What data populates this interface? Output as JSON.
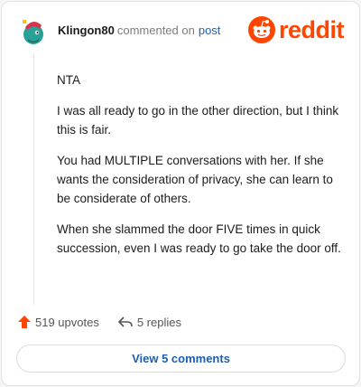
{
  "comment": {
    "username": "Klingon80",
    "action_text": "commented on",
    "post_link": "post",
    "paragraphs": [
      "NTA",
      "I was all ready to go in the other direction, but I think this is fair.",
      "You had MULTIPLE conversations with her. If she wants the consideration of privacy, she can learn to be considerate of others.",
      "When she slammed the door FIVE times in quick succession, even I was ready to go take the door off."
    ]
  },
  "brand": {
    "wordmark": "reddit",
    "icon": "reddit-snoo-icon",
    "color": "#ff4500"
  },
  "actions": {
    "upvotes_label": "519 upvotes",
    "upvote_icon": "upvote-arrow-icon",
    "replies_label": "5 replies",
    "reply_icon": "reply-arrow-icon"
  },
  "footer": {
    "view_comments_label": "View 5 comments"
  },
  "colors": {
    "accent": "#ff4500",
    "link": "#1a5fb4",
    "text": "#1c1c1c",
    "muted": "#7c7c7c"
  }
}
